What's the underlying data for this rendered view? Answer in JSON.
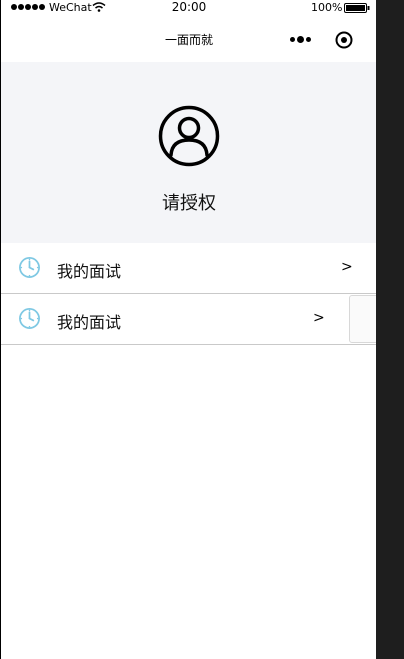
{
  "status_bar": {
    "carrier": "WeChat",
    "time": "20:00",
    "battery": "100%"
  },
  "nav": {
    "title": "一面而就"
  },
  "profile": {
    "auth_text": "请授权"
  },
  "list": {
    "items": [
      {
        "label": "我的面试",
        "arrow": ">"
      },
      {
        "label": "我的面试",
        "arrow": ">"
      }
    ]
  },
  "colors": {
    "profile_bg": "#f4f5f8",
    "icon_blue": "#7ec8e3",
    "outside_bg": "#1e1e1e"
  }
}
